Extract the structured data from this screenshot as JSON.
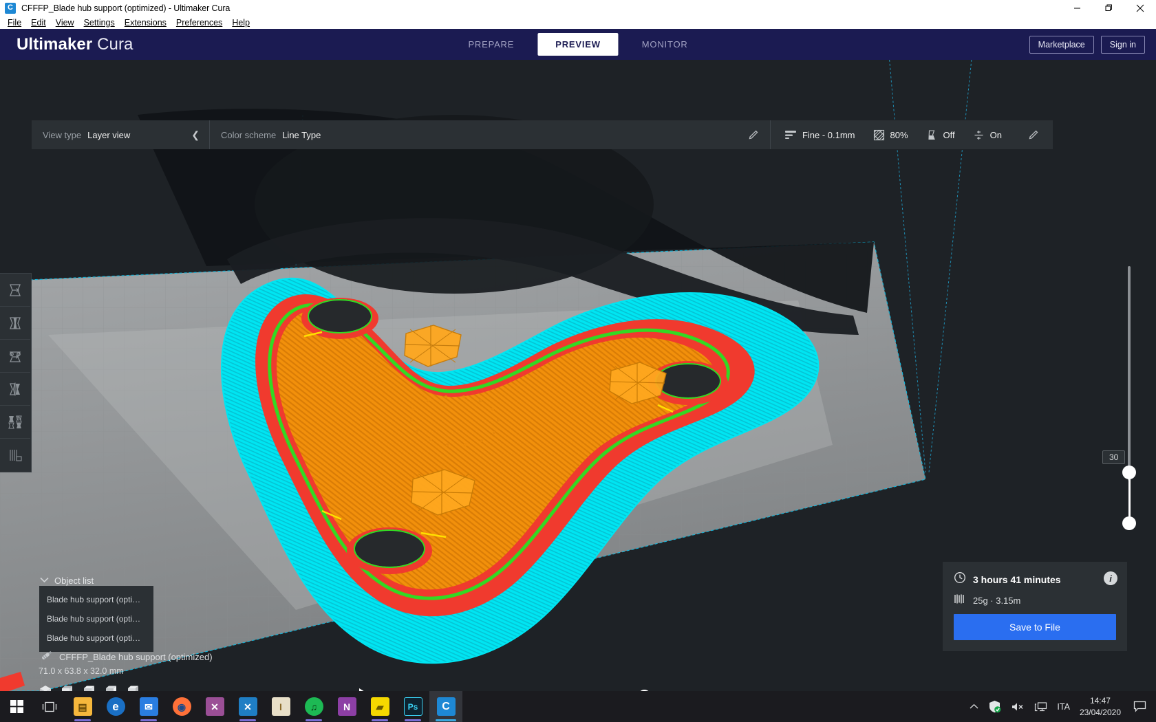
{
  "window": {
    "title": "CFFFP_Blade hub support (optimized) - Ultimaker Cura",
    "app_icon": "cura-logo-icon",
    "minimize": "minimize-icon",
    "maximize": "restore-icon",
    "close": "close-icon"
  },
  "menubar": {
    "items": [
      {
        "label": "File"
      },
      {
        "label": "Edit"
      },
      {
        "label": "View"
      },
      {
        "label": "Settings"
      },
      {
        "label": "Extensions"
      },
      {
        "label": "Preferences"
      },
      {
        "label": "Help"
      }
    ]
  },
  "header": {
    "brand_bold": "Ultimaker",
    "brand_light": "Cura",
    "tabs": [
      {
        "label": "PREPARE",
        "active": false
      },
      {
        "label": "PREVIEW",
        "active": true
      },
      {
        "label": "MONITOR",
        "active": false
      }
    ],
    "marketplace_label": "Marketplace",
    "signin_label": "Sign in",
    "accent_bg": "#1b1b52"
  },
  "settings_bar": {
    "view_type_label": "View type",
    "view_type_value": "Layer view",
    "collapse_icon": "chevron-left-icon",
    "color_scheme_label": "Color scheme",
    "color_scheme_value": "Line Type",
    "edit_icon": "pencil-icon",
    "profile_icon": "layer-height-icon",
    "profile_value": "Fine - 0.1mm",
    "infill_icon": "infill-icon",
    "infill_value": "80%",
    "support_icon": "support-icon",
    "support_value": "Off",
    "adhesion_icon": "adhesion-icon",
    "adhesion_value": "On",
    "settings_edit_icon": "pencil-icon"
  },
  "left_tools": [
    {
      "name": "move-tool-icon"
    },
    {
      "name": "scale-tool-icon"
    },
    {
      "name": "rotate-tool-icon"
    },
    {
      "name": "mirror-tool-icon"
    },
    {
      "name": "per-model-settings-tool-icon"
    },
    {
      "name": "support-blocker-tool-icon"
    }
  ],
  "layer_slider": {
    "value": "30",
    "upper_handle": "layer-slider-upper-handle",
    "lower_handle": "layer-slider-lower-handle"
  },
  "object_list": {
    "title": "Object list",
    "collapse_icon": "chevron-down-icon",
    "items": [
      {
        "label": "Blade hub support (optimize..."
      },
      {
        "label": "Blade hub support (optimize..."
      },
      {
        "label": "Blade hub support (optimize..."
      }
    ],
    "selected_icon": "printer-extruder-icon",
    "selected_name": "CFFFP_Blade hub support (optimized)",
    "dimensions": "71.0 x 63.8 x 32.0 mm"
  },
  "view_modes": [
    {
      "name": "view-3d-icon"
    },
    {
      "name": "view-front-icon"
    },
    {
      "name": "view-top-icon"
    },
    {
      "name": "view-left-icon"
    },
    {
      "name": "view-right-icon"
    }
  ],
  "playback": {
    "play_icon": "play-icon",
    "progress_percent": 100
  },
  "print_info": {
    "time_icon": "clock-icon",
    "time_value": "3 hours 41 minutes",
    "material_icon": "filament-icon",
    "material_value": "25g · 3.15m",
    "info_icon": "info-icon",
    "save_label": "Save to File",
    "save_color": "#2a6ef0"
  },
  "layer_colors": {
    "skirt": "#00e5f2",
    "wall_outer": "#f03a2e",
    "wall_inner": "#33d923",
    "infill": "#f2900b",
    "support": "#3fd1d1",
    "travel": "#2aa0c8"
  },
  "taskbar": {
    "start_icon": "windows-start-icon",
    "taskview_icon": "task-view-icon",
    "apps": [
      {
        "name": "file-explorer-icon",
        "glyph": "▤",
        "color": "#f6b73c",
        "running": true
      },
      {
        "name": "microsoft-edge-icon",
        "glyph": "e",
        "color": "#1a6fc4",
        "running": false
      },
      {
        "name": "mail-icon",
        "glyph": "✉",
        "color": "#2a7de1",
        "running": true
      },
      {
        "name": "firefox-icon",
        "glyph": "◉",
        "color": "#ff7139",
        "running": false
      },
      {
        "name": "visual-studio-icon",
        "glyph": "✕",
        "color": "#9b4f96",
        "running": false
      },
      {
        "name": "vs-code-icon",
        "glyph": "✕",
        "color": "#1f7ec4",
        "running": true
      },
      {
        "name": "ultimaker-legacy-icon",
        "glyph": "I",
        "color": "#e8dfc8",
        "running": false
      },
      {
        "name": "spotify-icon",
        "glyph": "♫",
        "color": "#1db954",
        "running": true
      },
      {
        "name": "onenote-icon",
        "glyph": "N",
        "color": "#8d3fa5",
        "running": false
      },
      {
        "name": "sticky-notes-icon",
        "glyph": "▰",
        "color": "#f5d800",
        "running": true
      },
      {
        "name": "photoshop-icon",
        "glyph": "Ps",
        "color": "#0d5f84",
        "running": true
      },
      {
        "name": "cura-taskbar-icon",
        "glyph": "C",
        "color": "#1e88d4",
        "running": true,
        "active": true
      }
    ],
    "tray": {
      "overflow_icon": "show-hidden-icons-icon",
      "defender_icon": "windows-security-icon",
      "volume_icon": "volume-muted-icon",
      "network_icon": "network-icon",
      "language": "ITA",
      "time": "14:47",
      "date": "23/04/2020",
      "notification_icon": "action-center-icon"
    }
  }
}
